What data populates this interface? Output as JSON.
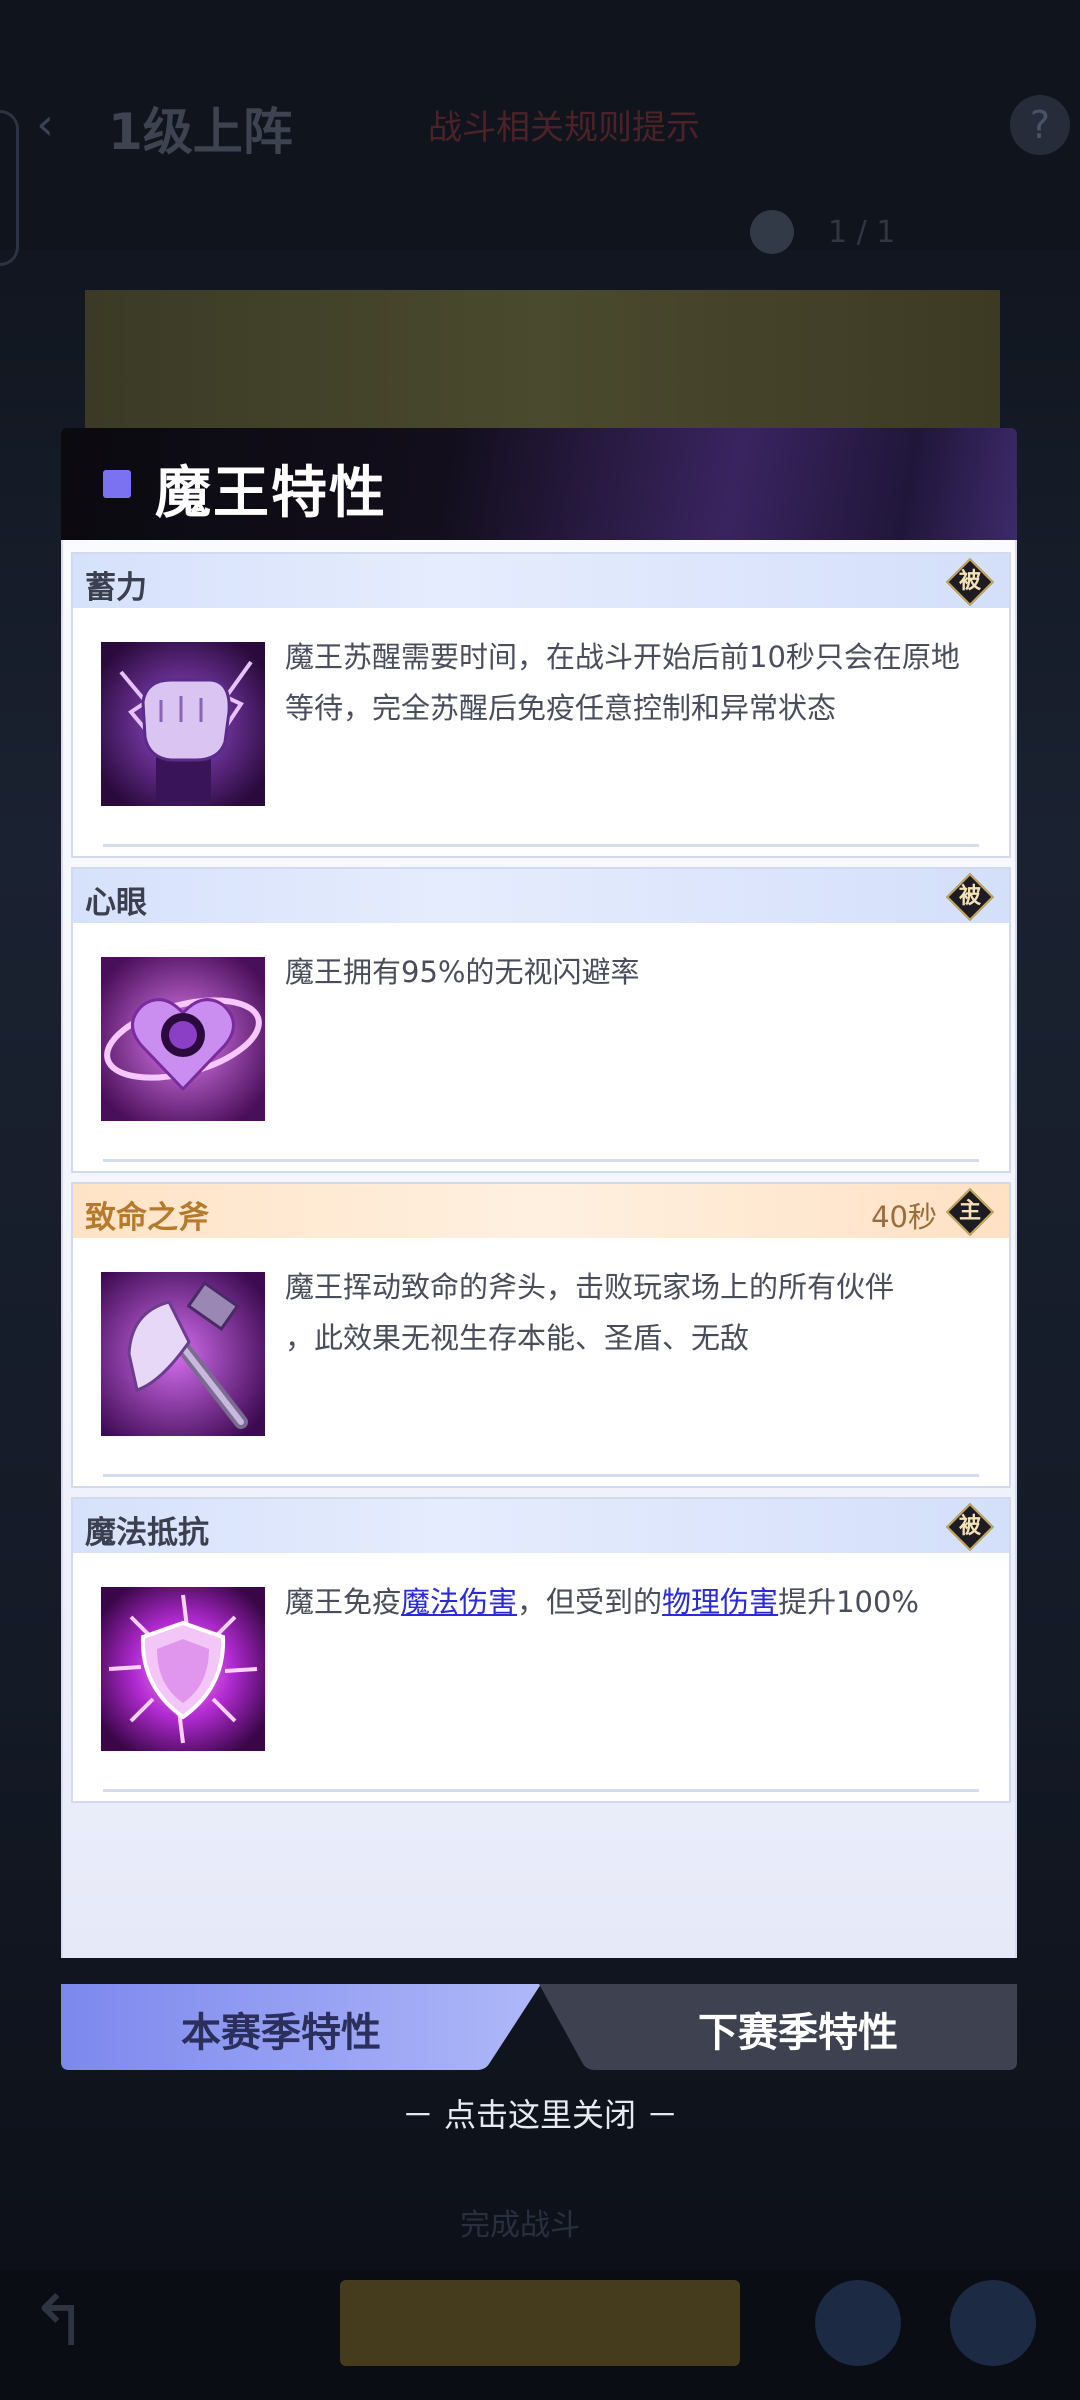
{
  "background": {
    "back_icon": "‹",
    "title": "1级上阵",
    "red_text": "战斗相关规则提示",
    "help_icon": "?",
    "small_text": "1 / 1",
    "mid_text": "完成战斗",
    "back_arrow": "↰"
  },
  "modal": {
    "title": "魔王特性",
    "cards": [
      {
        "name": "蓄力",
        "badge": "被",
        "icon": "fist-icon",
        "description": "魔王苏醒需要时间，在战斗开始后前10秒只会在原地等待，完全苏醒后免疫任意控制和异常状态"
      },
      {
        "name": "心眼",
        "badge": "被",
        "icon": "heart-eye-icon",
        "description": "魔王拥有95%的无视闪避率"
      },
      {
        "name": "致命之斧",
        "badge": "主",
        "cooldown": "40秒",
        "icon": "axe-icon",
        "description_line1": "魔王挥动致命的斧头，击败玩家场上的所有伙伴",
        "description_line2": "，此效果无视生存本能、圣盾、无敌"
      },
      {
        "name": "魔法抵抗",
        "badge": "被",
        "icon": "shield-icon",
        "desc_part1": "魔王免疫",
        "link1": "魔法伤害",
        "desc_part2": "，但受到的",
        "link2": "物理伤害",
        "desc_part3": "提升100%"
      }
    ],
    "tabs": [
      {
        "label": "本赛季特性",
        "active": true
      },
      {
        "label": "下赛季特性",
        "active": false
      }
    ]
  },
  "close_hint": "－ 点击这里关闭 －",
  "colors": {
    "accent": "#7b72f2",
    "tab_active": "#8f9cf4",
    "tab_inactive": "#3e4150",
    "link": "#2a2ad8"
  }
}
